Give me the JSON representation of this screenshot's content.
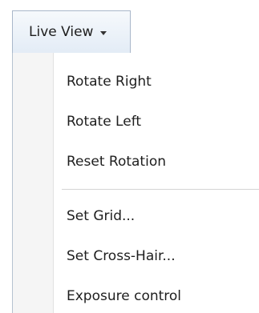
{
  "menu_button": {
    "label": "Live View"
  },
  "dropdown": {
    "group1": [
      {
        "label": "Rotate Right"
      },
      {
        "label": "Rotate Left"
      },
      {
        "label": "Reset Rotation"
      }
    ],
    "group2": [
      {
        "label": "Set Grid..."
      },
      {
        "label": "Set Cross-Hair..."
      },
      {
        "label": "Exposure control"
      }
    ]
  }
}
